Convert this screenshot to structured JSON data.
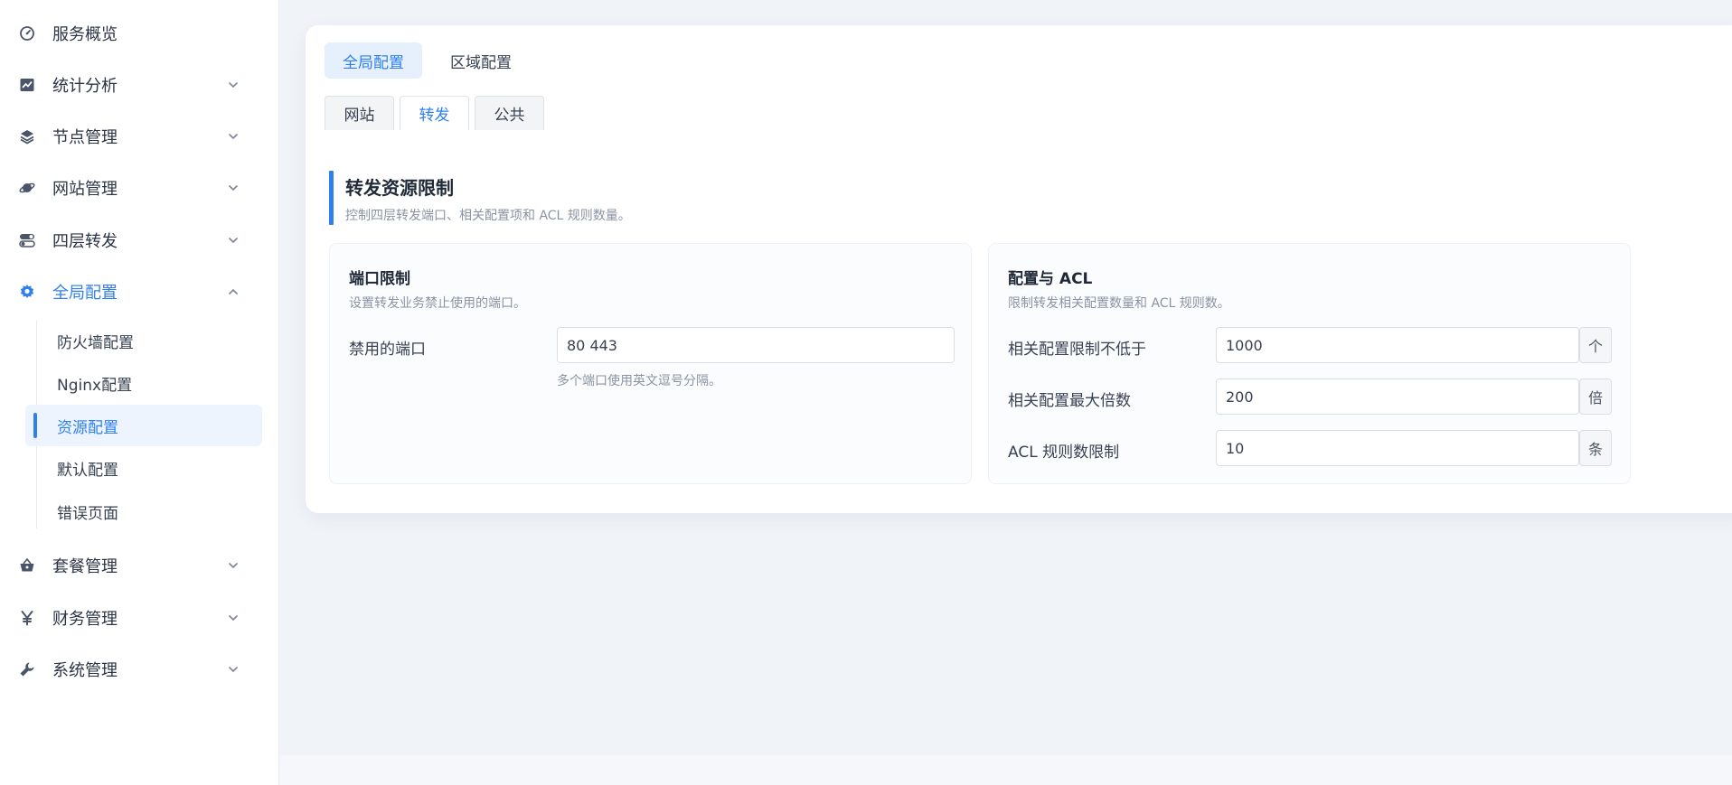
{
  "sidebar": {
    "items": [
      {
        "label": "服务概览",
        "icon": "dashboard-icon"
      },
      {
        "label": "统计分析",
        "icon": "chart-icon"
      },
      {
        "label": "节点管理",
        "icon": "layers-icon"
      },
      {
        "label": "网站管理",
        "icon": "planet-icon"
      },
      {
        "label": "四层转发",
        "icon": "toggle-icon"
      },
      {
        "label": "全局配置",
        "icon": "gear-icon"
      },
      {
        "label": "套餐管理",
        "icon": "basket-icon"
      },
      {
        "label": "财务管理",
        "icon": "yen-icon"
      },
      {
        "label": "系统管理",
        "icon": "wrench-icon"
      }
    ],
    "sub_items": [
      {
        "label": "防火墙配置"
      },
      {
        "label": "Nginx配置"
      },
      {
        "label": "资源配置"
      },
      {
        "label": "默认配置"
      },
      {
        "label": "错误页面"
      }
    ],
    "accent_color": "#2f80ed"
  },
  "main": {
    "segments": [
      {
        "label": "全局配置"
      },
      {
        "label": "区域配置"
      }
    ],
    "tabs": [
      {
        "label": "网站"
      },
      {
        "label": "转发"
      },
      {
        "label": "公共"
      }
    ],
    "section": {
      "title": "转发资源限制",
      "description": "控制四层转发端口、相关配置项和 ACL 规则数量。"
    },
    "port_panel": {
      "title": "端口限制",
      "description": "设置转发业务禁止使用的端口。",
      "field_label": "禁用的端口",
      "field_value": "80 443",
      "hint": "多个端口使用英文逗号分隔。"
    },
    "acl_panel": {
      "title": "配置与 ACL",
      "description": "限制转发相关配置数量和 ACL 规则数。",
      "fields": [
        {
          "label": "相关配置限制不低于",
          "value": "1000",
          "unit": "个"
        },
        {
          "label": "相关配置最大倍数",
          "value": "200",
          "unit": "倍"
        },
        {
          "label": "ACL 规则数限制",
          "value": "10",
          "unit": "条"
        }
      ]
    }
  }
}
